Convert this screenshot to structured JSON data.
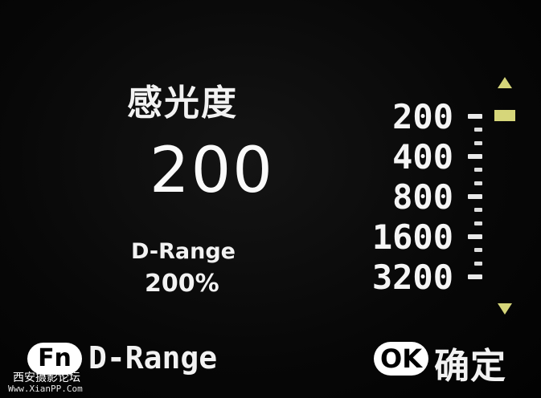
{
  "header": {
    "title": "感光度"
  },
  "current": {
    "iso": "200"
  },
  "drange": {
    "label": "D-Range",
    "value": "200%"
  },
  "scale": {
    "values": [
      "200",
      "400",
      "800",
      "1600",
      "3200"
    ],
    "selected": "200"
  },
  "footer": {
    "fn_key": "Fn",
    "fn_action": "D-Range",
    "ok_key": "OK",
    "ok_action": "确定"
  },
  "watermark": {
    "line1": "西安摄影论坛",
    "line2": "Www.XianPP.Com"
  },
  "colors": {
    "accent": "#d6d67a",
    "text": "#f2f2f2",
    "background": "#050505"
  },
  "icons": {
    "scroll_up": "triangle-up-icon",
    "scroll_down": "triangle-down-icon"
  }
}
